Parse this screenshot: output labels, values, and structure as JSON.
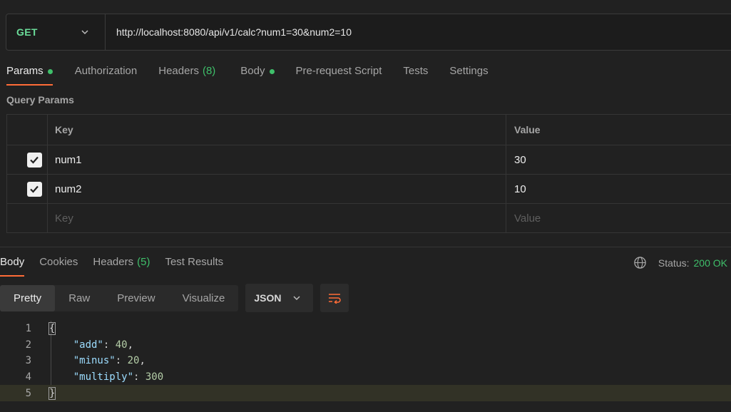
{
  "request": {
    "method": "GET",
    "url": "http://localhost:8080/api/v1/calc?num1=30&num2=10"
  },
  "request_tabs": [
    {
      "label": "Params",
      "dot": true
    },
    {
      "label": "Authorization"
    },
    {
      "label": "Headers",
      "count": "(8)"
    },
    {
      "label": "Body",
      "dot": true
    },
    {
      "label": "Pre-request Script"
    },
    {
      "label": "Tests"
    },
    {
      "label": "Settings"
    }
  ],
  "query_params": {
    "title": "Query Params",
    "header": {
      "key": "Key",
      "value": "Value"
    },
    "rows": [
      {
        "key": "num1",
        "value": "30",
        "checked": true
      },
      {
        "key": "num2",
        "value": "10",
        "checked": true
      }
    ],
    "empty_row": {
      "key_placeholder": "Key",
      "value_placeholder": "Value"
    }
  },
  "response_tabs": [
    {
      "label": "Body"
    },
    {
      "label": "Cookies"
    },
    {
      "label": "Headers",
      "count": "(5)"
    },
    {
      "label": "Test Results"
    }
  ],
  "status": {
    "label": "Status:",
    "value": "200 OK"
  },
  "view_modes": [
    "Pretty",
    "Raw",
    "Preview",
    "Visualize"
  ],
  "format": "JSON",
  "code": {
    "line_numbers": [
      "1",
      "2",
      "3",
      "4",
      "5"
    ],
    "open_brace": "{",
    "close_brace": "}",
    "entries": [
      {
        "key": "\"add\"",
        "value": "40",
        "comma": ","
      },
      {
        "key": "\"minus\"",
        "value": "20",
        "comma": ","
      },
      {
        "key": "\"multiply\"",
        "value": "300",
        "comma": ""
      }
    ]
  },
  "colors": {
    "accent": "#ff6c37",
    "get_method": "#6bdd9a",
    "success": "#3fbf6a",
    "background": "#212121"
  },
  "icons": [
    "chevron-down-icon",
    "checkmark-icon",
    "globe-icon",
    "wrap-lines-icon"
  ]
}
